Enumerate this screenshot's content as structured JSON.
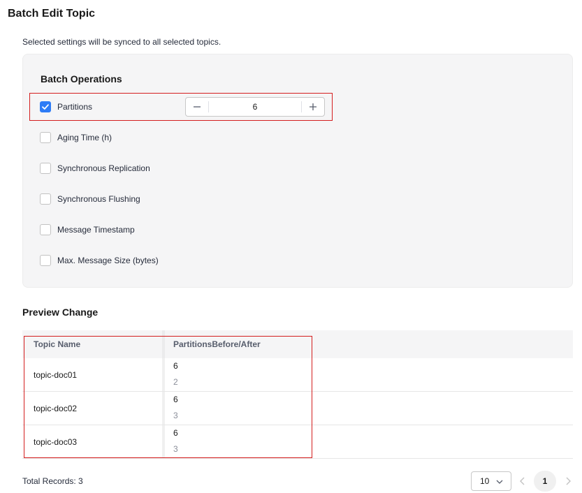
{
  "page": {
    "title": "Batch Edit Topic",
    "subtitle": "Selected settings will be synced to all selected topics."
  },
  "batch_operations": {
    "heading": "Batch Operations",
    "items": [
      {
        "label": "Partitions",
        "checked": true
      },
      {
        "label": "Aging Time (h)",
        "checked": false
      },
      {
        "label": "Synchronous Replication",
        "checked": false
      },
      {
        "label": "Synchronous Flushing",
        "checked": false
      },
      {
        "label": "Message Timestamp",
        "checked": false
      },
      {
        "label": "Max. Message Size (bytes)",
        "checked": false
      }
    ],
    "partitions_value": "6"
  },
  "preview": {
    "heading": "Preview Change",
    "columns": [
      "Topic Name",
      "PartitionsBefore/After"
    ],
    "rows": [
      {
        "name": "topic-doc01",
        "after": "6",
        "before": "2"
      },
      {
        "name": "topic-doc02",
        "after": "6",
        "before": "3"
      },
      {
        "name": "topic-doc03",
        "after": "6",
        "before": "3"
      }
    ]
  },
  "pagination": {
    "total_records": "Total Records: 3",
    "page_size": "10",
    "current_page": "1"
  },
  "colors": {
    "accent": "#2e7cf6",
    "highlight": "#d41e1e"
  }
}
